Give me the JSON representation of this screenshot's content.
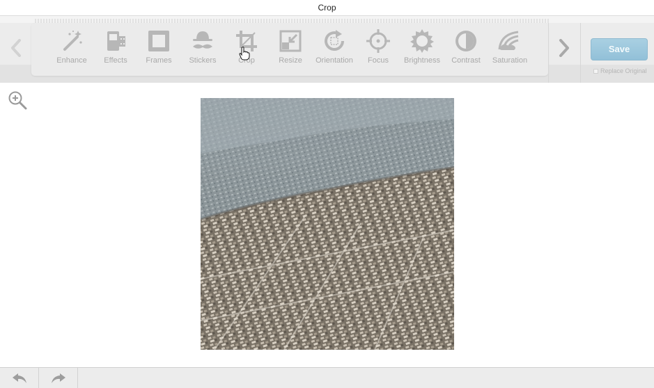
{
  "window": {
    "title": "Crop"
  },
  "toolbar": {
    "tools": [
      {
        "label": "Enhance",
        "icon": "magic-wand-icon"
      },
      {
        "label": "Effects",
        "icon": "film-strip-icon"
      },
      {
        "label": "Frames",
        "icon": "frame-icon"
      },
      {
        "label": "Stickers",
        "icon": "mustache-hat-icon"
      },
      {
        "label": "Crop",
        "icon": "crop-icon"
      },
      {
        "label": "Resize",
        "icon": "resize-icon"
      },
      {
        "label": "Orientation",
        "icon": "rotate-icon"
      },
      {
        "label": "Focus",
        "icon": "focus-target-icon"
      },
      {
        "label": "Brightness",
        "icon": "sun-icon"
      },
      {
        "label": "Contrast",
        "icon": "contrast-icon"
      },
      {
        "label": "Saturation",
        "icon": "rainbow-icon"
      }
    ],
    "save_label": "Save",
    "replace_original_label": "Replace Original"
  },
  "colors": {
    "save_button": "#9fc9de",
    "tool_icon": "#b7b7b7",
    "tool_label": "#a9a9a9"
  }
}
